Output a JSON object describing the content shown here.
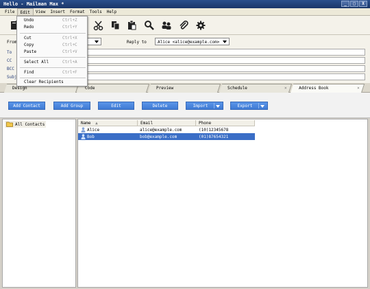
{
  "window": {
    "title": "Hello - Mailman Max *",
    "controls": [
      "_",
      "□",
      "X"
    ]
  },
  "menubar": {
    "items": [
      "File",
      "Edit",
      "View",
      "Insert",
      "Format",
      "Tools",
      "Help"
    ]
  },
  "edit_menu": {
    "items": [
      {
        "label": "Undo",
        "shortcut": "Ctrl+Z"
      },
      {
        "label": "Redo",
        "shortcut": "Ctrl+Y"
      },
      {
        "label": "Cut",
        "shortcut": "Ctrl+X"
      },
      {
        "label": "Copy",
        "shortcut": "Ctrl+C"
      },
      {
        "label": "Paste",
        "shortcut": "Ctrl+V"
      },
      {
        "label": "Select All",
        "shortcut": "Ctrl+A"
      },
      {
        "label": "Find",
        "shortcut": "Ctrl+F"
      },
      {
        "label": "Clear Recipients",
        "shortcut": ""
      }
    ]
  },
  "toolbar": {
    "icons": [
      "new-document-icon",
      "cut-icon",
      "copy-icon",
      "paste-icon",
      "search-icon",
      "contacts-icon",
      "attach-icon",
      "settings-gear-icon"
    ]
  },
  "compose": {
    "from_label": "From",
    "to_label": "To",
    "cc_label": "CC",
    "bcc_label": "BCC",
    "subject_label": "Subje",
    "reply_to_label": "Reply to",
    "reply_to_value": "Alice <alice@example.com>",
    "from_value": ""
  },
  "tabs": [
    {
      "label": "Design",
      "close": ""
    },
    {
      "label": "Code",
      "close": ""
    },
    {
      "label": "Preview",
      "close": ""
    },
    {
      "label": "Schedule",
      "close": "×"
    },
    {
      "label": "Address Book",
      "close": "×"
    }
  ],
  "address_book": {
    "buttons": {
      "add_contact": "Add Contact",
      "add_group": "Add Group",
      "edit": "Edit",
      "delete": "Delete",
      "import": "Import",
      "export": "Export"
    },
    "tree": {
      "all_contacts": "All Contacts"
    },
    "columns": {
      "name": "Name",
      "sort_indicator": "▲",
      "email": "Email",
      "phone": "Phone"
    },
    "rows": [
      {
        "name": "Alice",
        "email": "alice@example.com",
        "phone": "(10)12345678",
        "selected": false
      },
      {
        "name": "Bob",
        "email": "bob@example.com",
        "phone": "(01)87654321",
        "selected": true
      }
    ]
  },
  "colors": {
    "title_bar": "#1a3668",
    "button_blue": "#4a87de",
    "selection": "#3a6ec6"
  }
}
